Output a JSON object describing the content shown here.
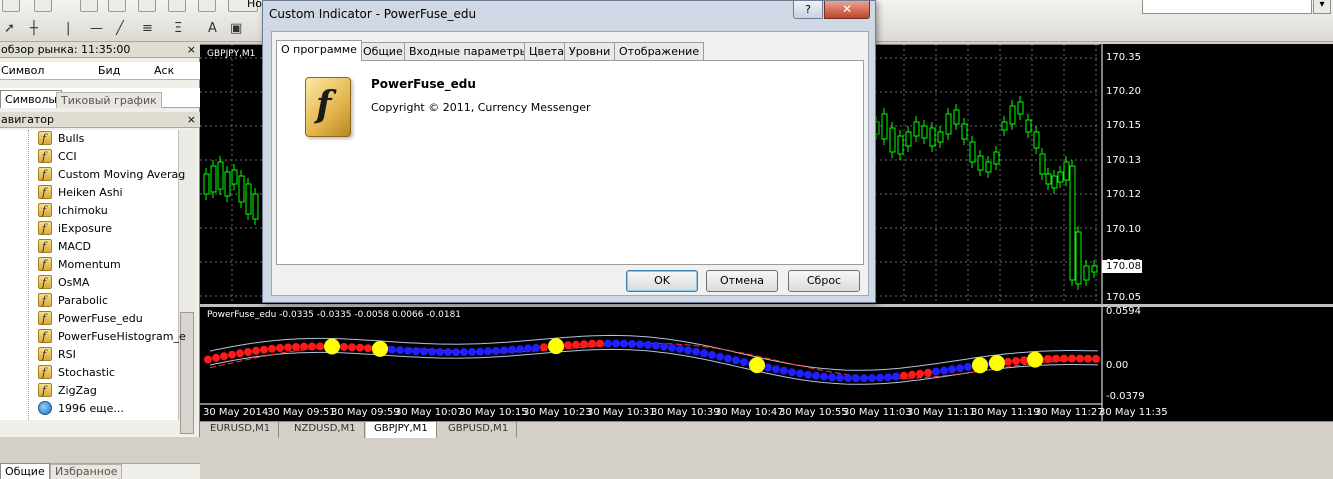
{
  "toolbar": {
    "partial_label": "Но"
  },
  "market_watch": {
    "title": "обзор рынка: 11:35:00",
    "close": "×",
    "columns": {
      "symbol": "Символ",
      "bid": "Бид",
      "ask": "Аск"
    },
    "tabs": [
      "Символы",
      "Тиковый график"
    ]
  },
  "navigator": {
    "title": "авигатор",
    "close": "×",
    "items": [
      "Bulls",
      "CCI",
      "Custom Moving Averag",
      "Heiken Ashi",
      "Ichimoku",
      "iExposure",
      "MACD",
      "Momentum",
      "OsMA",
      "Parabolic",
      "PowerFuse_edu",
      "PowerFuseHistogram_e",
      "RSI",
      "Stochastic",
      "ZigZag"
    ],
    "more": "1996 еще...",
    "bottom_tabs": [
      "Общие",
      "Избранное"
    ]
  },
  "chart": {
    "symbol": "GBPJPY,M1",
    "indicator_label": "PowerFuse_edu -0.0335 -0.0335 -0.0058 0.0066 -0.0181",
    "price_labels": [
      "170.35",
      "170.20",
      "170.15",
      "170.15",
      "170.13",
      "170.12",
      "170.10",
      "170.08",
      "170.05"
    ],
    "current_price": "170.08",
    "indicator_levels": [
      "0.0594",
      "0.00",
      "-0.0379"
    ],
    "time_labels": [
      "30 May 2014",
      "30 May 09:51",
      "30 May 09:59",
      "30 May 10:07",
      "30 May 10:15",
      "30 May 10:23",
      "30 May 10:31",
      "30 May 10:39",
      "30 May 10:47",
      "30 May 10:55",
      "30 May 11:03",
      "30 May 11:11",
      "30 May 11:19",
      "30 May 11:27",
      "30 May 11:35"
    ],
    "tabs": [
      "EURUSD,M1",
      "NZDUSD,M1",
      "GBPJPY,M1",
      "GBPUSD,M1"
    ],
    "active_tab": "GBPJPY,M1"
  },
  "dialog": {
    "title": "Custom Indicator - PowerFuse_edu",
    "help": "?",
    "close": "✕",
    "tabs": [
      "О программе",
      "Общие",
      "Входные параметры",
      "Цвета",
      "Уровни",
      "Отображение"
    ],
    "active_tab": "О программе",
    "indicator_name": "PowerFuse_edu",
    "copyright": "Copyright © 2011, Currency Messenger",
    "buttons": {
      "ok": "OK",
      "cancel": "Отмена",
      "reset": "Сброс"
    }
  }
}
